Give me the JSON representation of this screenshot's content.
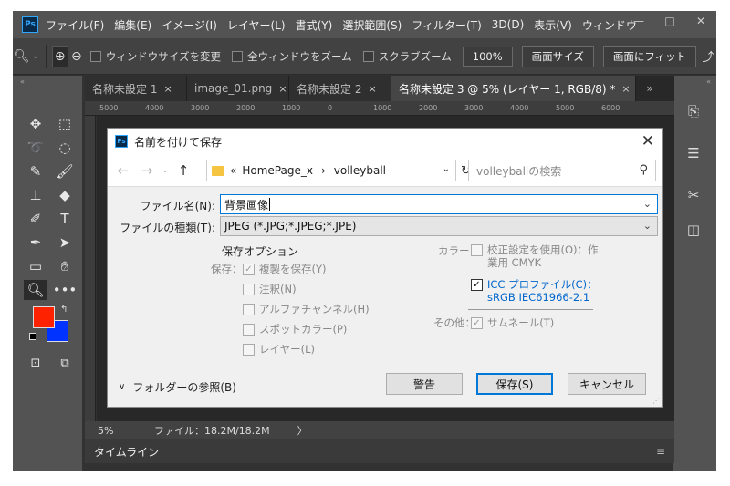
{
  "app": {
    "logo": "Ps",
    "menu": [
      "ファイル(F)",
      "編集(E)",
      "イメージ(I)",
      "レイヤー(L)",
      "書式(Y)",
      "選択範囲(S)",
      "フィルター(T)",
      "3D(D)",
      "表示(V)",
      "ウィンドウ"
    ],
    "window_buttons": [
      "—",
      "□",
      "✕"
    ]
  },
  "options_bar": {
    "resize_windows": "ウィンドウサイズを変更",
    "zoom_all": "全ウィンドウをズーム",
    "scrubby_zoom": "スクラブズーム",
    "zoom_value": "100%",
    "fit_screen": "画面サイズ",
    "fill_screen": "画面にフィット"
  },
  "tabs": [
    {
      "label": "名称未設定 1",
      "close": "×"
    },
    {
      "label": "image_01.png",
      "close": "×"
    },
    {
      "label": "名称未設定 2",
      "close": "×"
    },
    {
      "label": "名称未設定 3 @ 5% (レイヤー 1, RGB/8) *",
      "close": "×"
    }
  ],
  "tab_overflow": "»",
  "ruler_ticks": [
    "5000",
    "4000",
    "3000",
    "2000",
    "1000",
    "0",
    "1000",
    "2000",
    "3000",
    "4000",
    "5000",
    "6000"
  ],
  "status": {
    "zoom": "5%",
    "file_info": "ファイル：18.2M/18.2M",
    "arrow": "〉"
  },
  "timeline": {
    "label": "タイムライン"
  },
  "dialog": {
    "logo": "Ps",
    "title": "名前を付けて保存",
    "close": "✕",
    "path_prefix": "«",
    "path_1": "HomePage_x",
    "path_sep": "›",
    "path_2": "volleyball",
    "search_placeholder": "volleyballの検索",
    "filename_label": "ファイル名(N):",
    "filename_value": "背景画像",
    "filetype_label": "ファイルの種類(T):",
    "filetype_value": "JPEG (*.JPG;*.JPEG;*.JPE)",
    "save_options_title": "保存オプション",
    "save_label": "保存：",
    "save_copy": "複製を保存(Y)",
    "notes": "注釈(N)",
    "alpha": "アルファチャンネル(H)",
    "spot": "スポットカラー(P)",
    "layers": "レイヤー(L)",
    "color_label": "カラー：",
    "proof_line1": "校正設定を使用(O)：作",
    "proof_line2": "業用 CMYK",
    "icc_line1": "ICC プロファイル(C)：",
    "icc_line2": "sRGB IEC61966-2.1",
    "other_label": "その他：",
    "thumbnail": "サムネール(T)",
    "browse_folders": "フォルダーの参照(B)",
    "warning_button": "警告",
    "save_button": "保存(S)",
    "cancel_button": "キャンセル"
  },
  "colors": {
    "foreground": "#ff2200",
    "background": "#0033ff",
    "accent": "#0078d7"
  }
}
